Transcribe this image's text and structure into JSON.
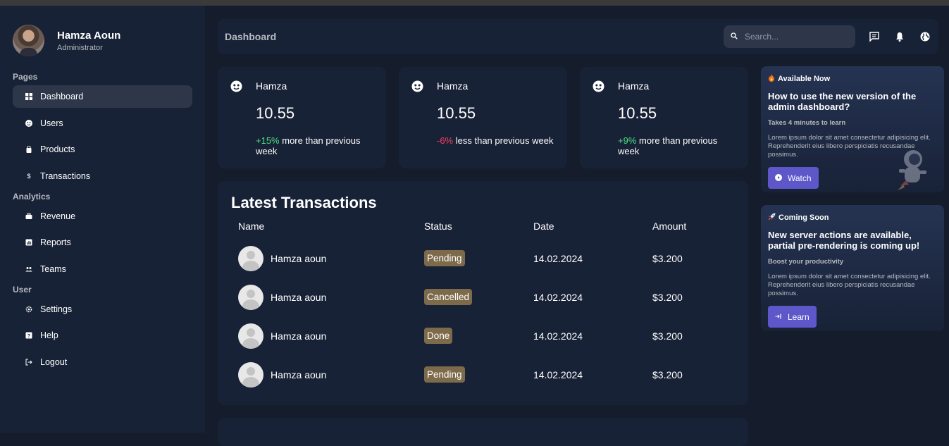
{
  "sidebar": {
    "user": {
      "name": "Hamza Aoun",
      "role": "Administrator"
    },
    "sections": [
      {
        "title": "Pages",
        "items": [
          {
            "label": "Dashboard",
            "icon": "dashboard-icon",
            "active": true
          },
          {
            "label": "Users",
            "icon": "users-icon"
          },
          {
            "label": "Products",
            "icon": "products-icon"
          },
          {
            "label": "Transactions",
            "icon": "dollar-icon"
          }
        ]
      },
      {
        "title": "Analytics",
        "items": [
          {
            "label": "Revenue",
            "icon": "briefcase-icon"
          },
          {
            "label": "Reports",
            "icon": "reports-icon"
          },
          {
            "label": "Teams",
            "icon": "teams-icon"
          }
        ]
      },
      {
        "title": "User",
        "items": [
          {
            "label": "Settings",
            "icon": "gear-icon"
          },
          {
            "label": "Help",
            "icon": "help-icon"
          },
          {
            "label": "Logout",
            "icon": "logout-icon"
          }
        ]
      }
    ]
  },
  "header": {
    "title": "Dashboard",
    "search_placeholder": "Search..."
  },
  "stat_cards": [
    {
      "title": "Hamza",
      "number": "10.55",
      "change": "+15%",
      "detail": "more than previous week",
      "trend": "positive"
    },
    {
      "title": "Hamza",
      "number": "10.55",
      "change": "-6%",
      "detail": "less than previous week",
      "trend": "negative"
    },
    {
      "title": "Hamza",
      "number": "10.55",
      "change": "+9%",
      "detail": "more than previous week",
      "trend": "positive"
    }
  ],
  "transactions": {
    "title": "Latest Transactions",
    "columns": [
      "Name",
      "Status",
      "Date",
      "Amount"
    ],
    "rows": [
      {
        "name": "Hamza aoun",
        "status": "Pending",
        "date": "14.02.2024",
        "amount": "$3.200"
      },
      {
        "name": "Hamza aoun",
        "status": "Cancelled",
        "date": "14.02.2024",
        "amount": "$3.200"
      },
      {
        "name": "Hamza aoun",
        "status": "Done",
        "date": "14.02.2024",
        "amount": "$3.200"
      },
      {
        "name": "Hamza aoun",
        "status": "Pending",
        "date": "14.02.2024",
        "amount": "$3.200"
      }
    ]
  },
  "promos": [
    {
      "tag": "Available Now",
      "tag_icon": "fire-icon",
      "title": "How to use the new version of the admin dashboard?",
      "subtitle": "Takes 4 minutes to learn",
      "description": "Lorem ipsum dolor sit amet consectetur adipisicing elit. Reprehenderit eius libero perspiciatis recusandae possimus.",
      "button": "Watch",
      "button_icon": "play-icon"
    },
    {
      "tag": "Coming Soon",
      "tag_icon": "rocket-icon",
      "title": "New server actions are available, partial pre-rendering is coming up!",
      "subtitle": "Boost your productivity",
      "description": "Lorem ipsum dolor sit amet consectetur adipisicing elit. Reprehenderit eius libero perspiciatis recusandae possimus.",
      "button": "Learn",
      "button_icon": "learn-icon"
    }
  ],
  "colors": {
    "background": "#151c2c",
    "panel": "#182237",
    "active": "#2e374a",
    "positive": "#4ade80",
    "negative": "#f43f5e",
    "badge": "#7d6a4a",
    "button": "#5d57c9"
  }
}
